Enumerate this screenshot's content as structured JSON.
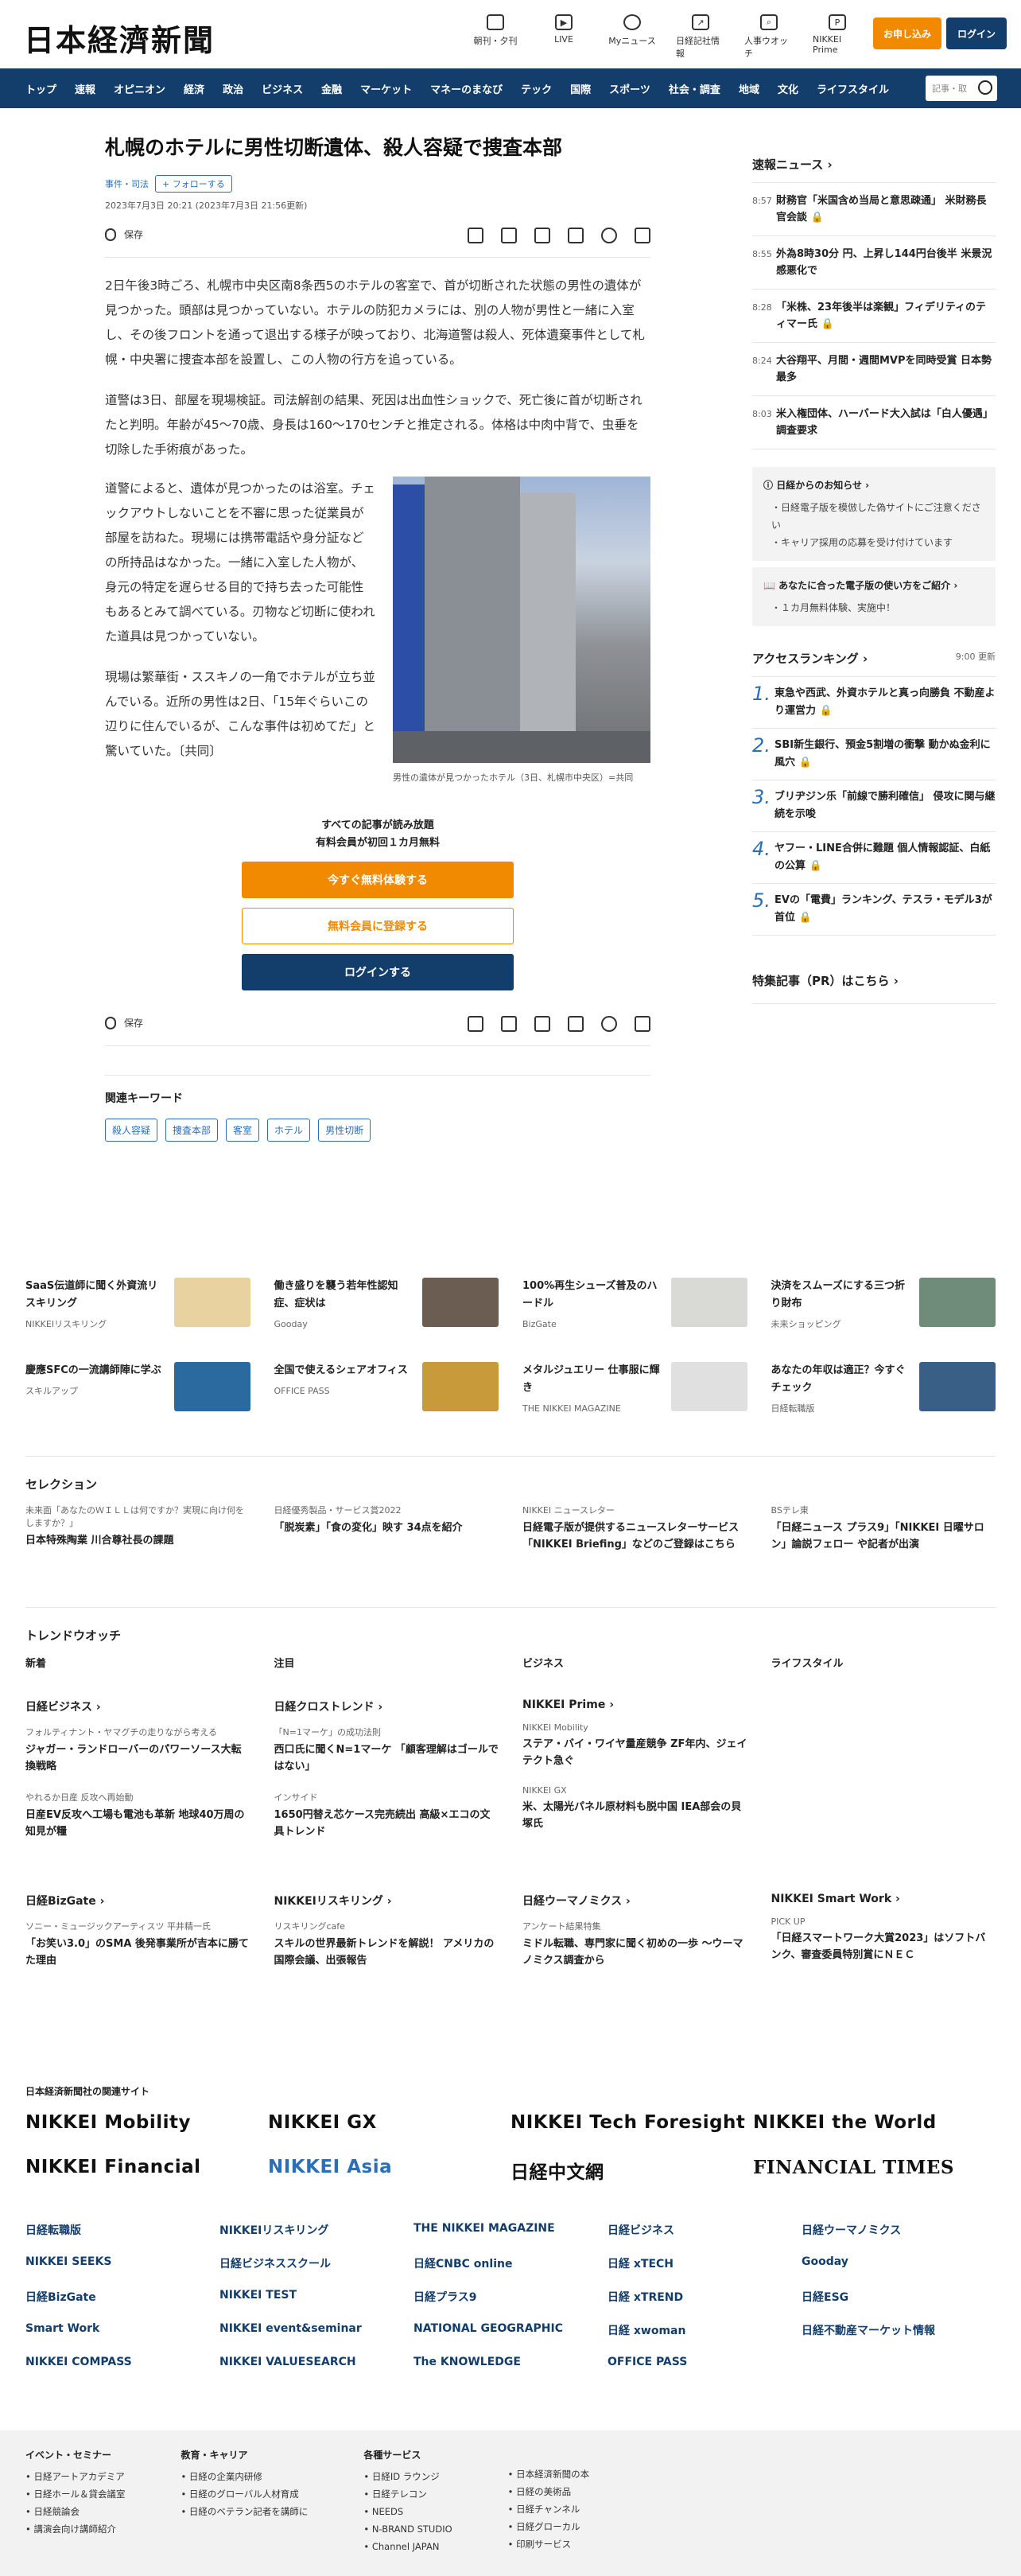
{
  "header": {
    "logo": "日本経濟新聞",
    "icons": [
      {
        "label": "朝刊・夕刊",
        "icon": "newspaper-icon"
      },
      {
        "label": "LIVE",
        "icon": "video-icon"
      },
      {
        "label": "Myニュース",
        "icon": "person-icon"
      },
      {
        "label": "日経記社情報",
        "icon": "chart-icon"
      },
      {
        "label": "人事ウオッチ",
        "icon": "magnifier-icon"
      },
      {
        "label": "NIKKEI Prime",
        "icon": "prime-icon"
      }
    ],
    "subscribe": "お申し込み",
    "login": "ログイン"
  },
  "nav": {
    "items": [
      "トップ",
      "速報",
      "オピニオン",
      "経済",
      "政治",
      "ビジネス",
      "金融",
      "マーケット",
      "マネーのまなび",
      "テック",
      "国際",
      "スポーツ",
      "社会・調査",
      "地域",
      "文化",
      "ライフスタイル"
    ],
    "search_placeholder": "記事・取"
  },
  "article": {
    "title": "札幌のホテルに男性切断遺体、殺人容疑で捜査本部",
    "tag": "事件・司法",
    "follow": "フォローする",
    "date": "2023年7月3日 20:21 (2023年7月3日 21:56更新)",
    "save": "保存",
    "p1": "2日午後3時ごろ、札幌市中央区南8条西5のホテルの客室で、首が切断された状態の男性の遺体が見つかった。頭部は見つかっていない。ホテルの防犯カメラには、別の人物が男性と一緒に入室し、その後フロントを通って退出する様子が映っており、北海道警は殺人、死体遺棄事件として札幌・中央署に捜査本部を設置し、この人物の行方を追っている。",
    "p2": "道警は3日、部屋を現場検証。司法解剖の結果、死因は出血性ショックで、死亡後に首が切断されたと判明。年齢が45〜70歳、身長は160〜170センチと推定される。体格は中肉中背で、虫垂を切除した手術痕があった。",
    "p3": "道警によると、遺体が見つかったのは浴室。チェックアウトしないことを不審に思った従業員が部屋を訪ねた。現場には携帯電話や身分証などの所持品はなかった。一緒に入室した人物が、身元の特定を遅らせる目的で持ち去った可能性もあるとみて調べている。刃物など切断に使われた道具は見つかっていない。",
    "p4": "現場は繁華街・ススキノの一角でホテルが立ち並んでいる。近所の男性は2日、「15年ぐらいこの辺りに住んでいるが、こんな事件は初めてだ」と驚いていた。〔共同〕",
    "caption": "男性の遺体が見つかったホテル（3日、札幌市中央区）=共同",
    "paywall": {
      "line1": "すべての記事が読み放題",
      "line2": "有料会員が初回１カ月無料",
      "btn1": "今すぐ無料体験する",
      "btn2": "無料会員に登録する",
      "btn3": "ログインする"
    },
    "related_title": "関連キーワード",
    "keywords": [
      "殺人容疑",
      "捜査本部",
      "客室",
      "ホテル",
      "男性切断"
    ]
  },
  "side": {
    "breaking_title": "速報ニュース",
    "breaking": [
      {
        "t": "8:57",
        "h": "財務官「米国含め当局と意思疎通」 米財務長官会談 🔒"
      },
      {
        "t": "8:55",
        "h": "外為8時30分 円、上昇し144円台後半 米景況感悪化で"
      },
      {
        "t": "8:28",
        "h": "「米株、23年後半は楽観」フィデリティのティマー氏 🔒"
      },
      {
        "t": "8:24",
        "h": "大谷翔平、月間・週間MVPを同時受賞 日本勢最多"
      },
      {
        "t": "8:03",
        "h": "米入権団体、ハーバード大入試は「白人優遇」 調査要求"
      }
    ],
    "notice1_title": "日経からのお知らせ",
    "notice1": [
      "日経電子版を模倣した偽サイトにご注意ください",
      "キャリア採用の応募を受け付けています"
    ],
    "notice2_title": "あなたに合った電子版の使い方をご紹介",
    "notice2": [
      "１カ月無料体験、実施中！"
    ],
    "ranking_title": "アクセスランキング",
    "ranking_time": "9:00 更新",
    "ranking": [
      "東急や西武、外資ホテルと真っ向勝負 不動産より運営力 🔒",
      "SBI新生銀行、預金5割増の衝撃 動かぬ金利に風穴 🔒",
      "ブリヂジン乐「前線で勝利確信」 侵攻に関与継続を示唆",
      "ヤフー・LINE合併に難題 個人情報認証、白紙の公算 🔒",
      "EVの「電費」ランキング、テスラ・モデル3が首位 🔒"
    ],
    "pr": "特集記事（PR）はこちら"
  },
  "ads": [
    {
      "title": "SaaS伝道師に聞く外資流リスキリング",
      "src": "NIKKEIリスキリング",
      "c": "#e8d3a0"
    },
    {
      "title": "働き盛りを襲う若年性認知症、症状は",
      "src": "Gooday",
      "c": "#6b5d52"
    },
    {
      "title": "100%再生シューズ普及のハードル",
      "src": "BizGate",
      "c": "#d9d9d6"
    },
    {
      "title": "決済をスムーズにする三つ折り財布",
      "src": "未来ショッピング",
      "c": "#6f8b7a"
    },
    {
      "title": "慶應SFCの一流講師陣に学ぶ",
      "src": "スキルアップ",
      "c": "#2b6a9e"
    },
    {
      "title": "全国で使えるシェアオフィス",
      "src": "OFFICE PASS",
      "c": "#c89a3a"
    },
    {
      "title": "メタルジュエリー 仕事服に輝き",
      "src": "THE NIKKEI MAGAZINE",
      "c": "#f2f2f2"
    },
    {
      "title": "あなたの年収は適正？今すぐチェック",
      "src": "日経転職版",
      "c": "#3a5f86"
    }
  ],
  "selection": {
    "title": "セレクション",
    "items": [
      {
        "k": "未来面「あなたのＷＩＬＬは何ですか？実現に向け何をしますか？」",
        "v": "日本特殊陶業 川合尊社長の課題"
      },
      {
        "k": "日経優秀製品・サービス賞2022",
        "v": "「脱炭素」「食の変化」映す 34点を紹介"
      },
      {
        "k": "NIKKEI ニュースレター",
        "v": "日経電子版が提供するニュースレターサービス「NIKKEI Briefing」などのご登録はこちら"
      },
      {
        "k": "BSテレ東",
        "v": "「日経ニュース プラス9」「NIKKEI 日曜サロン」論説フェロー や記者が出演"
      }
    ]
  },
  "trend": {
    "title": "トレンドウオッチ",
    "tabs": [
      "新着",
      "注目",
      "ビジネス",
      "ライフスタイル"
    ],
    "cols": [
      {
        "h": "日経ビジネス",
        "k1": "フォルティナント・ヤマグチの走りながら考える",
        "v1": "ジャガー・ランドローバーのパワーソース大転換戦略",
        "k2": "やれるか日産 反攻へ再始動",
        "v2": "日産EV反攻へ工場も電池も革新 地球40万周の知見が糧"
      },
      {
        "h": "日経クロストレンド",
        "k1": "「N=1マーケ」の成功法則",
        "v1": "西口氏に聞くN=1マーケ 「顧客理解はゴールではない」",
        "k2": "インサイド",
        "v2": "1650円替え芯ケース完売続出 高級×エコの文具トレンド"
      },
      {
        "h": "NIKKEI Prime",
        "k1": "NIKKEI Mobility",
        "v1": "ステア・バイ・ワイヤ量産競争 ZF年内、ジェイテクト急ぐ",
        "k2": "NIKKEI GX",
        "v2": "米、太陽光パネル原材料も脱中国 IEA部会の貝塚氏"
      }
    ],
    "cols2": [
      {
        "h": "日経BizGate",
        "k": "ソニー・ミュージックアーティスツ 平井精一氏",
        "v": "「お笑い3.0」のSMA 後発事業所が吉本に勝てた理由"
      },
      {
        "h": "NIKKEIリスキリング",
        "k": "リスキリングcafe",
        "v": "スキルの世界最新トレンドを解説！ アメリカの国際会議、出張報告"
      },
      {
        "h": "日経ウーマノミクス",
        "k": "アンケート結果特集",
        "v": "ミドル転職、専門家に聞く初めの一歩 〜ウーマノミクス調査から"
      },
      {
        "h": "NIKKEI Smart Work",
        "k": "PICK UP",
        "v": "「日経スマートワーク大賞2023」はソフトバンク、審査委員特別賞にＮＥＣ"
      }
    ]
  },
  "sites": {
    "title": "日本経済新聞社の関連サイト",
    "big": [
      "NIKKEI Mobility",
      "NIKKEI GX",
      "NIKKEI Tech Foresight",
      "NIKKEI the World",
      "NIKKEI Financial",
      "NIKKEI Asia",
      "日経中文網",
      "FINANCIAL TIMES"
    ],
    "small": [
      "日経転職版",
      "NIKKEIリスキリング",
      "THE NIKKEI MAGAZINE",
      "日経ビジネス",
      "日経ウーマノミクス",
      "NIKKEI SEEKS",
      "日経ビジネススクール",
      "日経CNBC online",
      "日経 xTECH",
      "Gooday",
      "日経BizGate",
      "NIKKEI TEST",
      "日経プラス9",
      "日経 xTREND",
      "日経ESG",
      "Smart Work",
      "NIKKEI event&seminar",
      "NATIONAL GEOGRAPHIC",
      "日経 xwoman",
      "日経不動産マーケット情報",
      "NIKKEI COMPASS",
      "NIKKEI VALUESEARCH",
      "The KNOWLEDGE",
      "OFFICE PASS",
      ""
    ]
  },
  "footer": [
    {
      "h": "イベント・セミナー",
      "items": [
        "日経アートアカデミア",
        "日経ホール＆貸会議室",
        "日経競論会",
        "講演会向け講師紹介"
      ]
    },
    {
      "h": "教育・キャリア",
      "items": [
        "日経の企業内研修",
        "日経のグローバル人材育成",
        "日経のベテラン記者を講師に"
      ]
    },
    {
      "h": "各種サービス",
      "items": [
        "日経ID ラウンジ",
        "日経テレコン",
        "NEEDS",
        "N-BRAND STUDIO",
        "Channel JAPAN"
      ]
    },
    {
      "h": "",
      "items": [
        "日本経済新聞の本",
        "日経の美術品",
        "日経チャンネル",
        "日経グローカル",
        "印刷サービス"
      ]
    }
  ]
}
